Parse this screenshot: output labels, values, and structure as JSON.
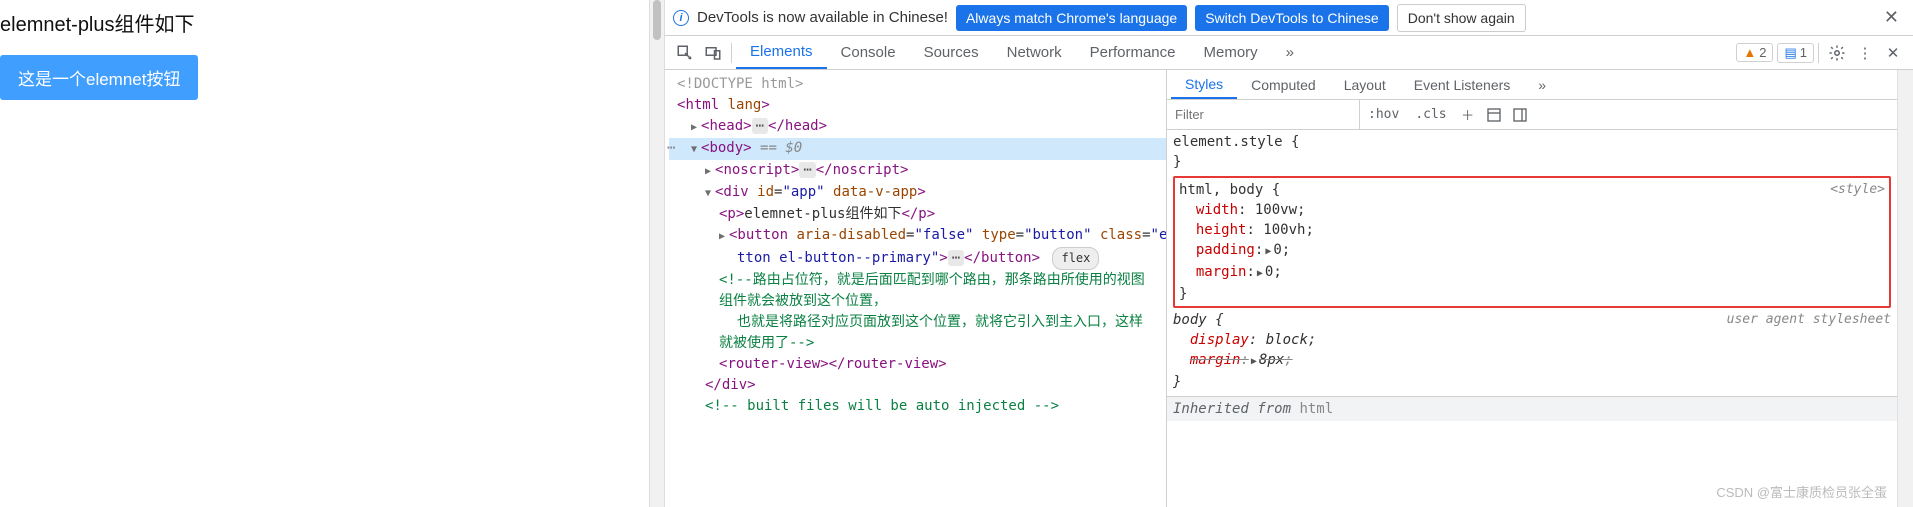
{
  "page": {
    "title": "elemnet-plus组件如下",
    "button_label": "这是一个elemnet按钮"
  },
  "infobar": {
    "message": "DevTools is now available in Chinese!",
    "btn_match": "Always match Chrome's language",
    "btn_switch": "Switch DevTools to Chinese",
    "btn_dont": "Don't show again"
  },
  "tabs": {
    "elements": "Elements",
    "console": "Console",
    "sources": "Sources",
    "network": "Network",
    "performance": "Performance",
    "memory": "Memory",
    "more": "»",
    "warn_count": "2",
    "msg_count": "1"
  },
  "dom": {
    "doctype": "<!DOCTYPE html>",
    "html_open": "html",
    "html_attr": "lang",
    "head": "head",
    "body": "body",
    "body_sel": "== $0",
    "noscript": "noscript",
    "div_id_n": "id",
    "div_id_v": "\"app\"",
    "div_data": "data-v-app",
    "p_text": "elemnet-plus组件如下",
    "btn_attrs1_n": "aria-disabled",
    "btn_attrs1_v": "\"false\"",
    "btn_attrs2_n": "type",
    "btn_attrs2_v": "\"button\"",
    "btn_attrs3_n": "class",
    "btn_attrs3_v": "\"el-bu",
    "btn_line2": "tton el-button--primary\"",
    "flex": "flex",
    "comment1": "<!--路由占位符，就是后面匹配到哪个路由，那条路由所使用的视图",
    "comment2": "组件就会被放到这个位置，",
    "comment3": "也就是将路径对应页面放到这个位置，就将它引入到主入口，这样",
    "comment4": "就被使用了-->",
    "router": "router-view",
    "comment5": "<!-- built files will be auto injected -->"
  },
  "styles_tabs": {
    "styles": "Styles",
    "computed": "Computed",
    "layout": "Layout",
    "listeners": "Event Listeners",
    "more": "»"
  },
  "filter": {
    "placeholder": "Filter",
    "hov": ":hov",
    "cls": ".cls"
  },
  "rules": {
    "r0_sel": "element.style",
    "r1_sel": "html, body",
    "r1_src": "<style>",
    "r1_p1n": "width",
    "r1_p1v": "100vw",
    "r1_p2n": "height",
    "r1_p2v": "100vh",
    "r1_p3n": "padding",
    "r1_p3v": "0",
    "r1_p4n": "margin",
    "r1_p4v": "0",
    "r2_sel": "body",
    "r2_src": "user agent stylesheet",
    "r2_p1n": "display",
    "r2_p1v": "block",
    "r2_p2n": "margin",
    "r2_p2v": "8px",
    "inherit_label": "Inherited from",
    "inherit_from": "html"
  },
  "watermark": "CSDN @富士康质检员张全蛋"
}
